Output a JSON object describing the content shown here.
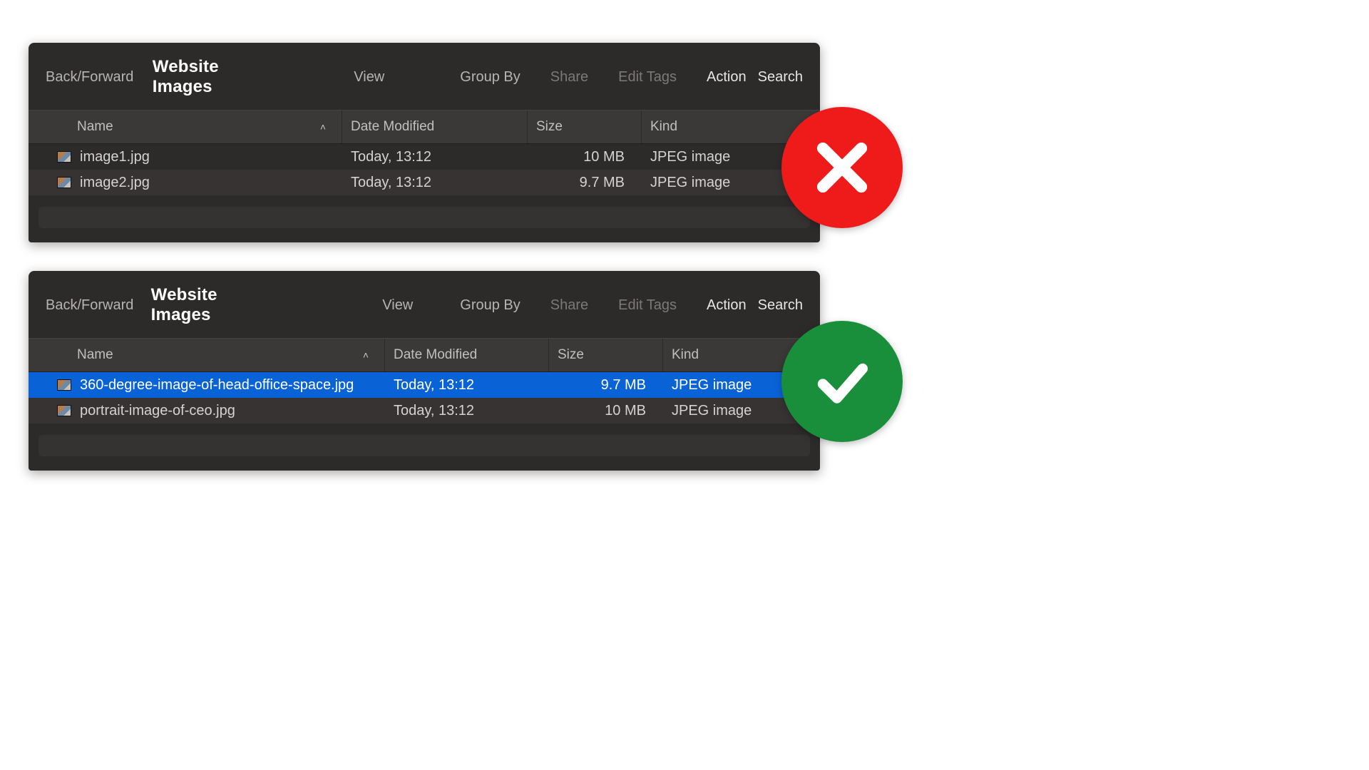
{
  "colors": {
    "bad": "#ef1a1a",
    "good": "#1a8f3b",
    "selection": "#0a63d6"
  },
  "bad": {
    "toolbar": {
      "back_forward": "Back/Forward",
      "title": "Website Images",
      "view": "View",
      "group_by": "Group By",
      "share": "Share",
      "edit_tags": "Edit Tags",
      "action": "Action",
      "search": "Search"
    },
    "columns": {
      "name": "Name",
      "date": "Date Modified",
      "size": "Size",
      "kind": "Kind"
    },
    "sort_indicator": "˄",
    "rows": [
      {
        "name": "image1.jpg",
        "date": "Today, 13:12",
        "size": "10 MB",
        "kind": "JPEG image",
        "selected": false,
        "alt": false
      },
      {
        "name": "image2.jpg",
        "date": "Today, 13:12",
        "size": "9.7 MB",
        "kind": "JPEG image",
        "selected": false,
        "alt": true
      }
    ]
  },
  "good": {
    "toolbar": {
      "back_forward": "Back/Forward",
      "title": "Website Images",
      "view": "View",
      "group_by": "Group By",
      "share": "Share",
      "edit_tags": "Edit Tags",
      "action": "Action",
      "search": "Search"
    },
    "columns": {
      "name": "Name",
      "date": "Date Modified",
      "size": "Size",
      "kind": "Kind"
    },
    "sort_indicator": "˄",
    "rows": [
      {
        "name": "360-degree-image-of-head-office-space.jpg",
        "date": "Today, 13:12",
        "size": "9.7 MB",
        "kind": "JPEG image",
        "selected": true,
        "alt": false
      },
      {
        "name": "portrait-image-of-ceo.jpg",
        "date": "Today, 13:12",
        "size": "10 MB",
        "kind": "JPEG image",
        "selected": false,
        "alt": true
      }
    ]
  }
}
